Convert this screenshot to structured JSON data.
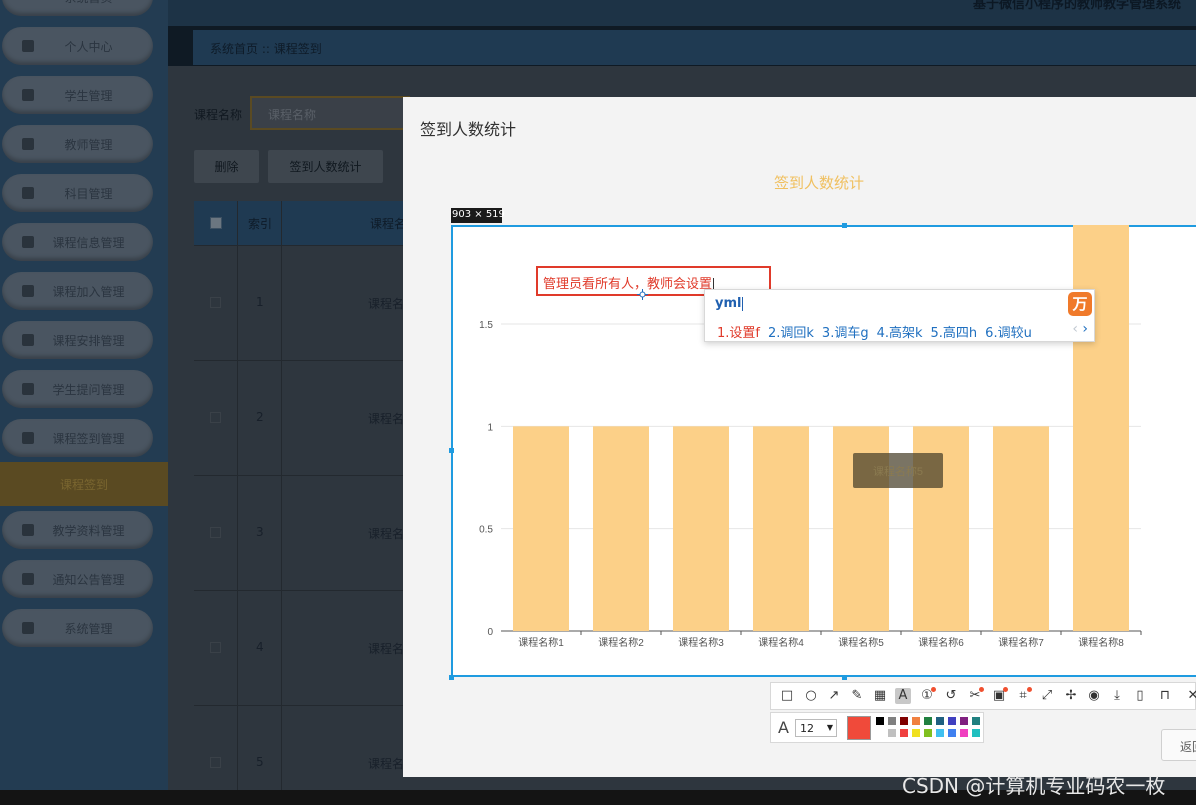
{
  "app": {
    "topbar_title": "基于微信小程序的教师教学管理系统",
    "breadcrumb": "系统首页  ::  课程签到"
  },
  "sidebar": {
    "top_partial": "系统首页",
    "items": [
      "个人中心",
      "学生管理",
      "教师管理",
      "科目管理",
      "课程信息管理",
      "课程加入管理",
      "课程安排管理",
      "学生提问管理",
      "课程签到管理"
    ],
    "active": "课程签到",
    "items_after": [
      "教学资料管理",
      "通知公告管理",
      "系统管理"
    ]
  },
  "search": {
    "label": "课程名称",
    "placeholder": "课程名称"
  },
  "toolbar": {
    "delete_label": "删除",
    "stats_label": "签到人数统计"
  },
  "table": {
    "headers": {
      "index": "索引",
      "name": "课程名"
    },
    "rows": [
      {
        "index": "1",
        "name": "课程名"
      },
      {
        "index": "2",
        "name": "课程名"
      },
      {
        "index": "3",
        "name": "课程名"
      },
      {
        "index": "4",
        "name": "课程名"
      },
      {
        "index": "5",
        "name": "课程名"
      }
    ]
  },
  "modal": {
    "title": "签到人数统计",
    "return_label": "返回"
  },
  "chart_data": {
    "type": "bar",
    "title": "签到人数统计",
    "categories": [
      "课程名称1",
      "课程名称2",
      "课程名称3",
      "课程名称4",
      "课程名称5",
      "课程名称6",
      "课程名称7",
      "课程名称8"
    ],
    "values": [
      1,
      1,
      1,
      1,
      1,
      1,
      1,
      2
    ],
    "yticks": [
      "0",
      "0.5",
      "1",
      "1.5"
    ],
    "ylim": [
      0,
      2
    ],
    "grid": true,
    "bar_color": "#fcd088",
    "tooltip_label": "课程名称5"
  },
  "snip": {
    "size_label": "903 × 519",
    "annotation_text": "管理员看所有人，教师会设置",
    "accent_color": "#1f9be0",
    "annotation_color": "#e03a2a"
  },
  "ime": {
    "input": "yml",
    "logo": "万",
    "candidates": [
      "1.设置f",
      "2.调回k",
      "3.调车g",
      "4.高架k",
      "5.高四h",
      "6.调较u"
    ]
  },
  "tools": {
    "icons": [
      "rectangle-icon",
      "ellipse-icon",
      "arrow-icon",
      "pencil-icon",
      "mosaic-icon",
      "text-icon",
      "number-icon",
      "undo-icon",
      "redo-icon",
      "pin-icon",
      "ocr-icon",
      "scroll-icon",
      "pushpin-icon",
      "record-icon",
      "download-icon",
      "copy-icon",
      "save-icon",
      "close-icon",
      "expand-icon"
    ],
    "font_size": "12",
    "current_color": "#f04a3a",
    "palette_row1": [
      "#000000",
      "#808080",
      "#800000",
      "#f08040",
      "#208040",
      "#206080",
      "#4040c0",
      "#802080",
      "#208080"
    ],
    "palette_row2": [
      "#ffffff",
      "#c0c0c0",
      "#f04040",
      "#f0e020",
      "#80c020",
      "#40c0f0",
      "#4080f0",
      "#f040c0",
      "#20c0c0"
    ]
  },
  "watermark": "CSDN @计算机专业码农一枚"
}
